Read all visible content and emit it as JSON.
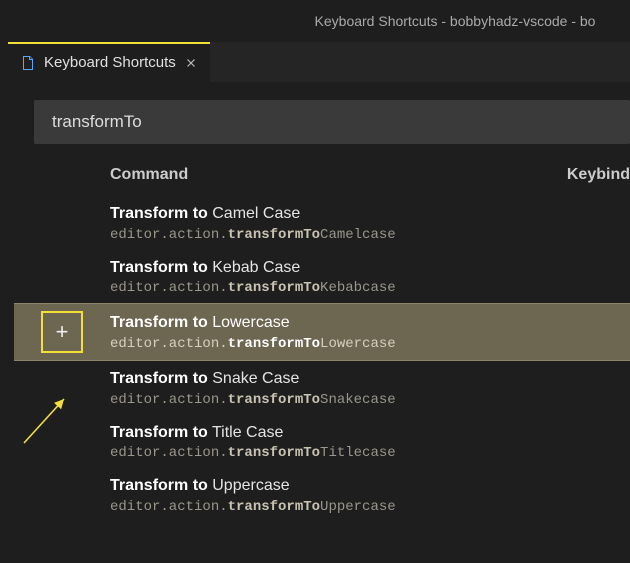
{
  "window": {
    "title": "Keyboard Shortcuts - bobbyhadz-vscode - bo"
  },
  "tab": {
    "label": "Keyboard Shortcuts"
  },
  "search": {
    "value": "transformTo",
    "placeholder": ""
  },
  "columns": {
    "command": "Command",
    "keybinding": "Keybind"
  },
  "add_button": {
    "glyph": "+"
  },
  "selected_index": 2,
  "rows": [
    {
      "label_bold": "Transform to",
      "label_rest": " Camel Case",
      "id_pre": "editor.action.",
      "id_bold": "transformTo",
      "id_post": "Camelcase"
    },
    {
      "label_bold": "Transform to",
      "label_rest": " Kebab Case",
      "id_pre": "editor.action.",
      "id_bold": "transformTo",
      "id_post": "Kebabcase"
    },
    {
      "label_bold": "Transform to",
      "label_rest": " Lowercase",
      "id_pre": "editor.action.",
      "id_bold": "transformTo",
      "id_post": "Lowercase"
    },
    {
      "label_bold": "Transform to",
      "label_rest": " Snake Case",
      "id_pre": "editor.action.",
      "id_bold": "transformTo",
      "id_post": "Snakecase"
    },
    {
      "label_bold": "Transform to",
      "label_rest": " Title Case",
      "id_pre": "editor.action.",
      "id_bold": "transformTo",
      "id_post": "Titlecase"
    },
    {
      "label_bold": "Transform to",
      "label_rest": " Uppercase",
      "id_pre": "editor.action.",
      "id_bold": "transformTo",
      "id_post": "Uppercase"
    }
  ]
}
